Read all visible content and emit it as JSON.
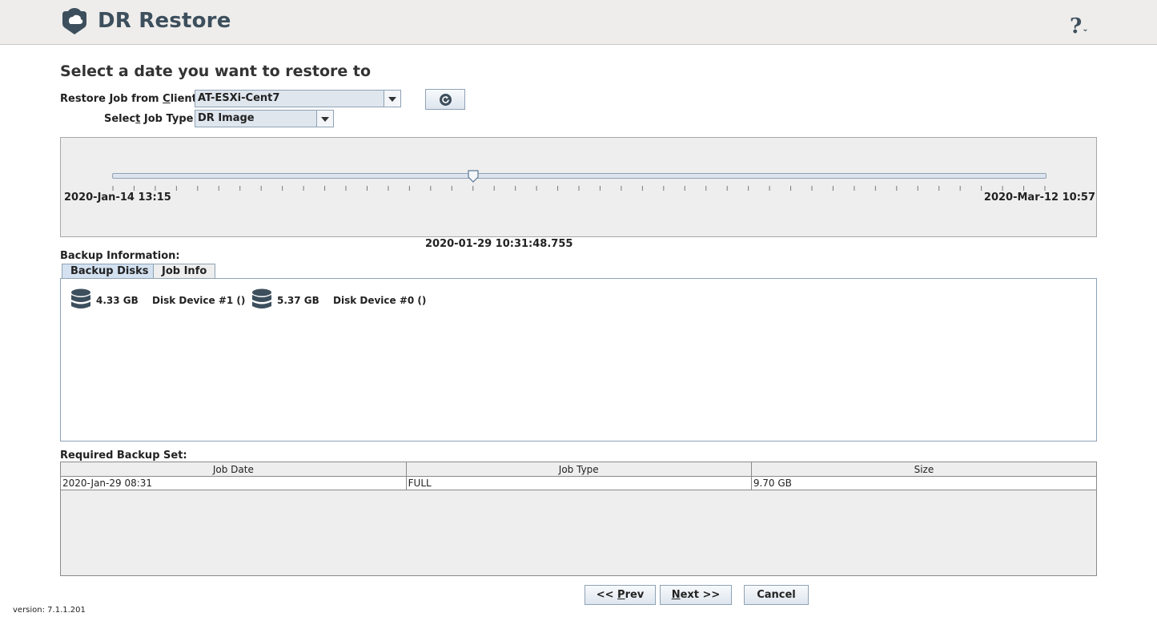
{
  "header": {
    "app_title": "DR Restore",
    "help_label": "?",
    "help_caret": "⌄"
  },
  "page": {
    "title": "Select a date you want to restore to"
  },
  "form": {
    "client": {
      "label_pre": "Restore Job from ",
      "label_mnemonic": "C",
      "label_post": "lient:",
      "value": "AT-ESXi-Cent7"
    },
    "job_type": {
      "label_pre": "Selec",
      "label_mnemonic": "t",
      "label_post": " Job Type:",
      "value": "DR Image"
    },
    "refresh_icon": "refresh-icon"
  },
  "timeline": {
    "start_label": "2020-Jan-14 13:15",
    "end_label": "2020-Mar-12 10:57",
    "selected_label": "2020-01-29 10:31:48.755",
    "position_fraction": 0.387
  },
  "backup_info": {
    "label": "Backup Information:",
    "tabs": [
      {
        "label": "Backup Disks",
        "active": true
      },
      {
        "label": "Job Info",
        "active": false
      }
    ],
    "disks": [
      {
        "size": "4.33 GB",
        "name": "Disk Device #1 ()",
        "icon": "database-icon"
      },
      {
        "size": "5.37 GB",
        "name": "Disk Device #0 ()",
        "icon": "database-icon"
      }
    ]
  },
  "backup_set": {
    "label": "Required Backup Set:",
    "columns": [
      "Job Date",
      "Job Type",
      "Size"
    ],
    "rows": [
      [
        "2020-Jan-29 08:31",
        "FULL",
        "9.70 GB"
      ]
    ]
  },
  "buttons": {
    "prev": {
      "pre": "<< ",
      "mnemonic": "P",
      "post": "rev"
    },
    "next": {
      "pre": "",
      "mnemonic": "N",
      "post": "ext >>"
    },
    "cancel": {
      "label": "Cancel"
    }
  },
  "footer": {
    "version": "version: 7.1.1.201"
  },
  "colors": {
    "header_bg": "#eeedeb",
    "brand_text": "#3d4f5d",
    "accent_border": "#8fa2b5",
    "active_tab": "#d3e1f0"
  }
}
